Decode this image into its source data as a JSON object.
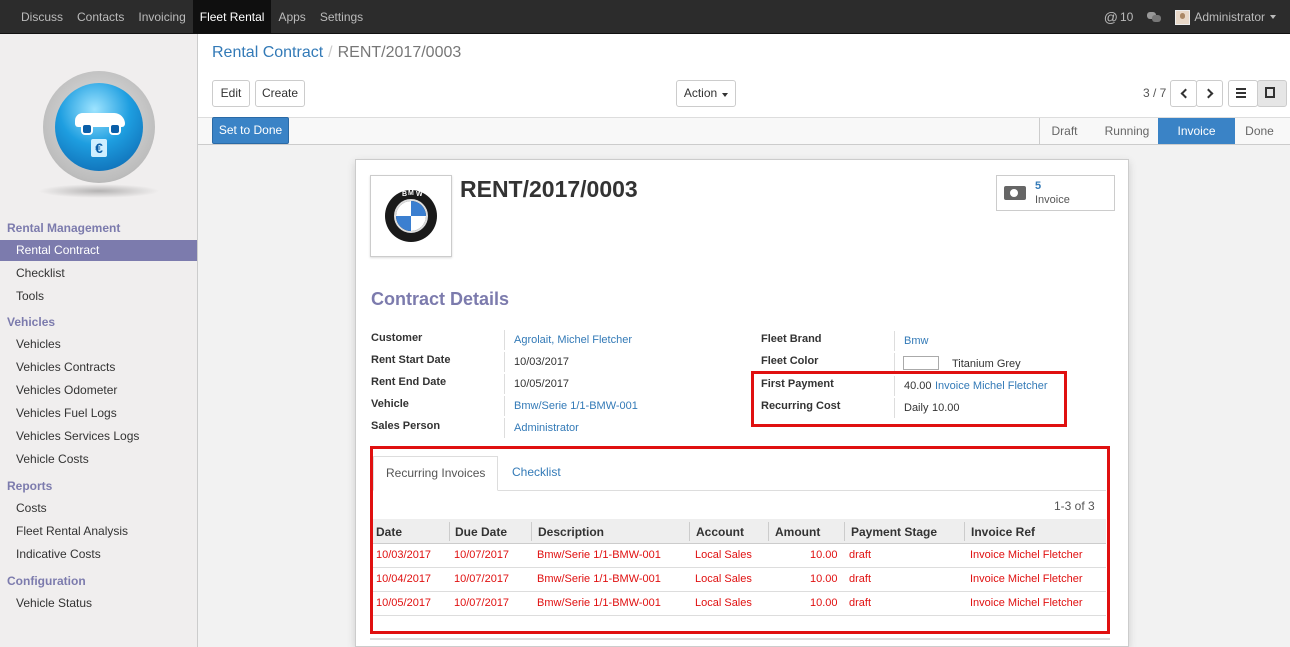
{
  "topbar": {
    "menu": [
      "Discuss",
      "Contacts",
      "Invoicing",
      "Fleet Rental",
      "Apps",
      "Settings"
    ],
    "active_menu": "Fleet Rental",
    "mentions_count": "10",
    "user": "Administrator"
  },
  "sidebar": {
    "sections": [
      {
        "title": "Rental Management",
        "items": [
          "Rental Contract",
          "Checklist",
          "Tools"
        ]
      },
      {
        "title": "Vehicles",
        "items": [
          "Vehicles",
          "Vehicles Contracts",
          "Vehicles Odometer",
          "Vehicles Fuel Logs",
          "Vehicles Services Logs",
          "Vehicle Costs"
        ]
      },
      {
        "title": "Reports",
        "items": [
          "Costs",
          "Fleet Rental Analysis",
          "Indicative Costs"
        ]
      },
      {
        "title": "Configuration",
        "items": [
          "Vehicle Status"
        ]
      }
    ],
    "active_item": "Rental Contract"
  },
  "breadcrumb": {
    "parent": "Rental Contract",
    "separator": "/",
    "current": "RENT/2017/0003"
  },
  "buttons": {
    "edit": "Edit",
    "create": "Create",
    "action": "Action",
    "set_to_done": "Set to Done"
  },
  "pager": {
    "text": "3 / 7"
  },
  "statusbar": {
    "stages": [
      "Draft",
      "Running",
      "Invoice",
      "Done"
    ],
    "active": "Invoice"
  },
  "record": {
    "title": "RENT/2017/0003",
    "brand_logo_text": [
      "B",
      "M",
      "W"
    ],
    "smart_button": {
      "count": "5",
      "label": "Invoice"
    },
    "section_title": "Contract Details",
    "left_fields": [
      {
        "label": "Customer",
        "value": "Agrolait, Michel Fletcher",
        "link": true
      },
      {
        "label": "Rent Start Date",
        "value": "10/03/2017",
        "link": false
      },
      {
        "label": "Rent End Date",
        "value": "10/05/2017",
        "link": false
      },
      {
        "label": "Vehicle",
        "value": "Bmw/Serie 1/1-BMW-001",
        "link": true
      },
      {
        "label": "Sales Person",
        "value": "Administrator",
        "link": true
      }
    ],
    "right_fields": {
      "fleet_brand": {
        "label": "Fleet Brand",
        "value": "Bmw"
      },
      "fleet_color": {
        "label": "Fleet Color",
        "value": "Titanium Grey"
      },
      "first_payment": {
        "label": "First Payment",
        "amount": "40.00",
        "invoice": "Invoice Michel Fletcher"
      },
      "recurring_cost": {
        "label": "Recurring Cost",
        "period": "Daily",
        "amount": "10.00"
      }
    }
  },
  "notebook": {
    "tabs": [
      "Recurring Invoices",
      "Checklist"
    ],
    "active_tab": "Recurring Invoices",
    "pager": "1-3 of 3",
    "columns": [
      "Date",
      "Due Date",
      "Description",
      "Account",
      "Amount",
      "Payment Stage",
      "Invoice Ref"
    ],
    "rows": [
      [
        "10/03/2017",
        "10/07/2017",
        "Bmw/Serie 1/1-BMW-001",
        "Local Sales",
        "10.00",
        "draft",
        "Invoice Michel Fletcher"
      ],
      [
        "10/04/2017",
        "10/07/2017",
        "Bmw/Serie 1/1-BMW-001",
        "Local Sales",
        "10.00",
        "draft",
        "Invoice Michel Fletcher"
      ],
      [
        "10/05/2017",
        "10/07/2017",
        "Bmw/Serie 1/1-BMW-001",
        "Local Sales",
        "10.00",
        "draft",
        "Invoice Michel Fletcher"
      ]
    ]
  },
  "colors": {
    "brand": "#7c7bad",
    "primary": "#3a83c6",
    "highlight": "#e01010",
    "link": "#337ab7"
  }
}
